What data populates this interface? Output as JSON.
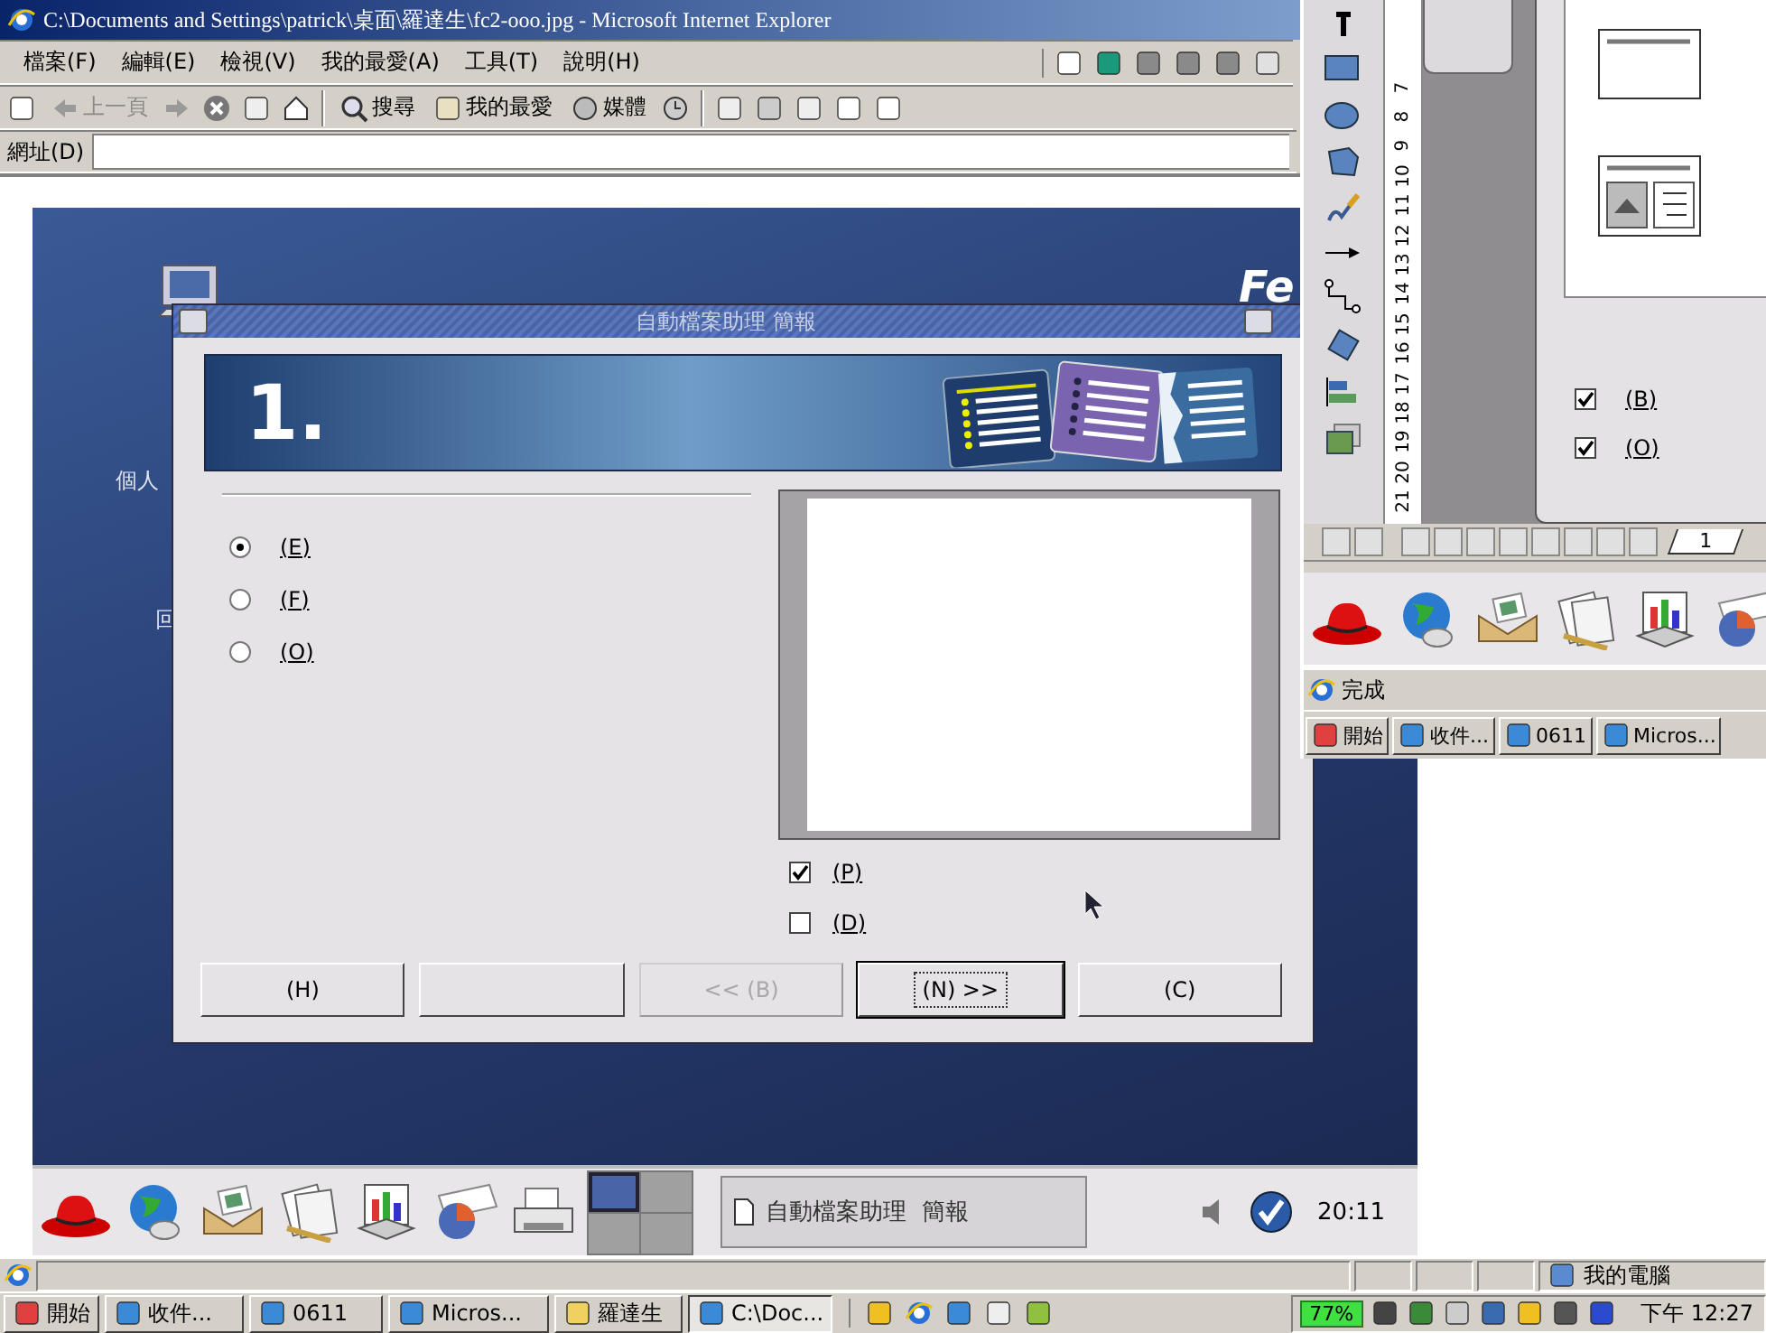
{
  "ie_window": {
    "title": "C:\\Documents and Settings\\patrick\\桌面\\羅達生\\fc2-ooo.jpg - Microsoft Internet Explorer"
  },
  "menu": [
    "檔案(F)",
    "編輯(E)",
    "檢視(V)",
    "我的最愛(A)",
    "工具(T)",
    "說明(H)"
  ],
  "toolbar": [
    {
      "label": "上一頁",
      "disabled": true
    },
    {
      "label": "搜尋",
      "disabled": false
    },
    {
      "label": "我的最愛",
      "disabled": false
    },
    {
      "label": "媒體",
      "disabled": false
    }
  ],
  "address": {
    "label": "網址(D)"
  },
  "screenshot": {
    "desktop": {
      "labels": [
        "個人",
        "回"
      ],
      "logo": "Fe"
    },
    "dialog": {
      "title": "自動檔案助理 簡報",
      "step": "1.",
      "options": [
        {
          "label": "(E)",
          "selected": true
        },
        {
          "label": "(F)",
          "selected": false
        },
        {
          "label": "(O)",
          "selected": false
        }
      ],
      "checkboxes": [
        {
          "label": "(P)",
          "checked": true
        },
        {
          "label": "(D)",
          "checked": false
        }
      ],
      "buttons": [
        {
          "label": "(H)",
          "disabled": false,
          "default": false
        },
        {
          "disabled": false,
          "default": false
        },
        {
          "label": "<< (B)",
          "disabled": true,
          "default": false
        },
        {
          "label": "(N) >>",
          "disabled": false,
          "default": true
        },
        {
          "label": "(C)",
          "disabled": false,
          "default": false
        }
      ]
    },
    "panel": {
      "workspaces": [
        {
          "selected": true
        },
        {
          "selected": false
        },
        {
          "selected": false
        },
        {
          "selected": false
        }
      ],
      "task": "自動檔案助理  簡報",
      "clock": "20:11"
    }
  },
  "side_window": {
    "ruler": [
      "7",
      "8",
      "9",
      "10",
      "11",
      "12",
      "13",
      "14",
      "15",
      "16",
      "17",
      "18",
      "19",
      "20",
      "21"
    ],
    "checkboxes": [
      {
        "label": "(B)",
        "checked": true
      },
      {
        "label": "(O)",
        "checked": true
      }
    ],
    "page_tab": "1",
    "status": "完成",
    "start": "開始",
    "taskbar": [
      {
        "label": "收件..."
      },
      {
        "label": "0611"
      },
      {
        "label": "Micros..."
      }
    ]
  },
  "status_bar": {
    "zone": "我的電腦"
  },
  "taskbar": {
    "start": "開始",
    "items": [
      {
        "label": "收件...",
        "selected": false
      },
      {
        "label": "0611",
        "selected": false
      },
      {
        "label": "Micros...",
        "selected": false
      },
      {
        "label": "羅達生",
        "selected": false
      },
      {
        "label": "C:\\Doc...",
        "selected": true
      }
    ],
    "battery": "77%",
    "clock": "下午 12:27"
  }
}
